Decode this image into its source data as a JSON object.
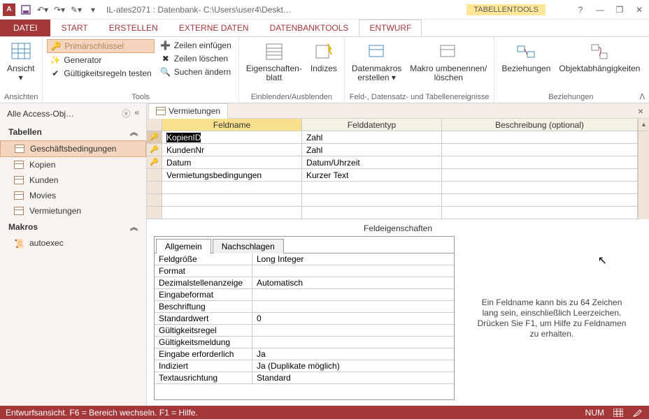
{
  "titlebar": {
    "app_letter": "A",
    "title": "IL-ates2071 : Datenbank- C:\\Users\\user4\\Deskt…",
    "context_tab": "TABELLENTOOLS"
  },
  "tabs": {
    "file": "DATEI",
    "start": "START",
    "erstellen": "ERSTELLEN",
    "externe": "EXTERNE DATEN",
    "dbtools": "DATENBANKTOOLS",
    "entwurf": "ENTWURF"
  },
  "ribbon": {
    "ansicht": "Ansicht",
    "ansichten": "Ansichten",
    "primaer": "Primärschlüssel",
    "generator": "Generator",
    "regeln": "Gültigkeitsregeln testen",
    "einfuegen": "Zeilen einfügen",
    "loeschen": "Zeilen löschen",
    "suchen": "Suchen ändern",
    "tools": "Tools",
    "eigblatt": "Eigenschaften-\nblatt",
    "indizes": "Indizes",
    "einblenden": "Einblenden/Ausblenden",
    "makros": "Datenmakros\nerstellen ▾",
    "umbenennen": "Makro umbenennen/\nlöschen",
    "feldereignisse": "Feld-, Datensatz- und Tabellenereignisse",
    "beziehungen": "Beziehungen",
    "objektabh": "Objektabhängigkeiten",
    "beziehungen_grp": "Beziehungen"
  },
  "nav": {
    "title": "Alle Access-Obj…",
    "tabellen": "Tabellen",
    "makros_h": "Makros",
    "items": [
      "Geschäftsbedingungen",
      "Kopien",
      "Kunden",
      "Movies",
      "Vermietungen"
    ],
    "macro": "autoexec"
  },
  "doctab": "Vermietungen",
  "grid": {
    "headers": [
      "Feldname",
      "Felddatentyp",
      "Beschreibung (optional)"
    ],
    "rows": [
      {
        "name": "KopienID",
        "type": "Zahl",
        "pk": true,
        "selected": true
      },
      {
        "name": "KundenNr",
        "type": "Zahl",
        "pk": true,
        "selected": false
      },
      {
        "name": "Datum",
        "type": "Datum/Uhrzeit",
        "pk": true,
        "selected": false
      },
      {
        "name": "Vermietungsbedingungen",
        "type": "Kurzer Text",
        "pk": false,
        "selected": false
      }
    ],
    "props_label": "Feldeigenschaften"
  },
  "props": {
    "tab_general": "Allgemein",
    "tab_lookup": "Nachschlagen",
    "rows": [
      {
        "n": "Feldgröße",
        "v": "Long Integer"
      },
      {
        "n": "Format",
        "v": ""
      },
      {
        "n": "Dezimalstellenanzeige",
        "v": "Automatisch"
      },
      {
        "n": "Eingabeformat",
        "v": ""
      },
      {
        "n": "Beschriftung",
        "v": ""
      },
      {
        "n": "Standardwert",
        "v": "0"
      },
      {
        "n": "Gültigkeitsregel",
        "v": ""
      },
      {
        "n": "Gültigkeitsmeldung",
        "v": ""
      },
      {
        "n": "Eingabe erforderlich",
        "v": "Ja"
      },
      {
        "n": "Indiziert",
        "v": "Ja (Duplikate möglich)"
      },
      {
        "n": "Textausrichtung",
        "v": "Standard"
      }
    ],
    "help": "Ein Feldname kann bis zu 64 Zeichen lang sein, einschließlich Leerzeichen. Drücken Sie F1, um Hilfe zu Feldnamen zu erhalten."
  },
  "status": {
    "left": "Entwurfsansicht. F6 = Bereich wechseln. F1 = Hilfe.",
    "num": "NUM"
  }
}
